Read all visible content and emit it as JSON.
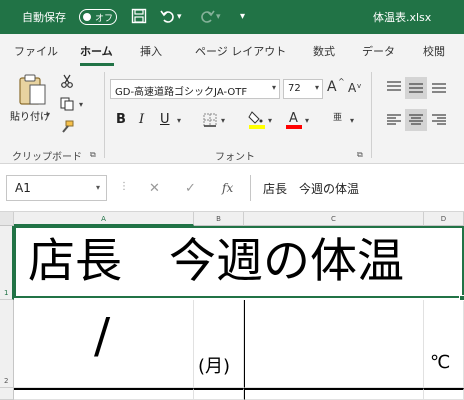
{
  "titlebar": {
    "autosave_label": "自動保存",
    "toggle_label": "オフ",
    "save_icon": "save-icon",
    "undo_icon": "undo-icon",
    "redo_icon": "redo-icon",
    "customize_icon": "customize-icon",
    "filename": "体温表.xlsx",
    "color": "#217346"
  },
  "tabs": [
    {
      "label": "ファイル"
    },
    {
      "label": "ホーム",
      "active": true
    },
    {
      "label": "挿入"
    },
    {
      "label": "ページ レイアウト"
    },
    {
      "label": "数式"
    },
    {
      "label": "データ"
    },
    {
      "label": "校閲"
    }
  ],
  "clipboard": {
    "paste_label": "貼り付け",
    "group_label": "クリップボード"
  },
  "font": {
    "family": "GD-高速道路ゴシックJA-OTF",
    "size": "72",
    "group_label": "フォント",
    "grow_label": "A",
    "shrink_label": "A",
    "bold_label": "B",
    "italic_label": "I",
    "underline_label": "U",
    "phonetic_label": "亜"
  },
  "formula_bar": {
    "name_box": "A1",
    "fx_label": "fx",
    "cancel_label": "✕",
    "enter_label": "✓",
    "content": "店長　今週の体温"
  },
  "columns": [
    "A",
    "B",
    "C",
    "D"
  ],
  "rows": [
    "1",
    "2"
  ],
  "cells": {
    "A1": "店長　今週の体温",
    "A2": "/",
    "B2": "(月)",
    "D2": "℃"
  }
}
